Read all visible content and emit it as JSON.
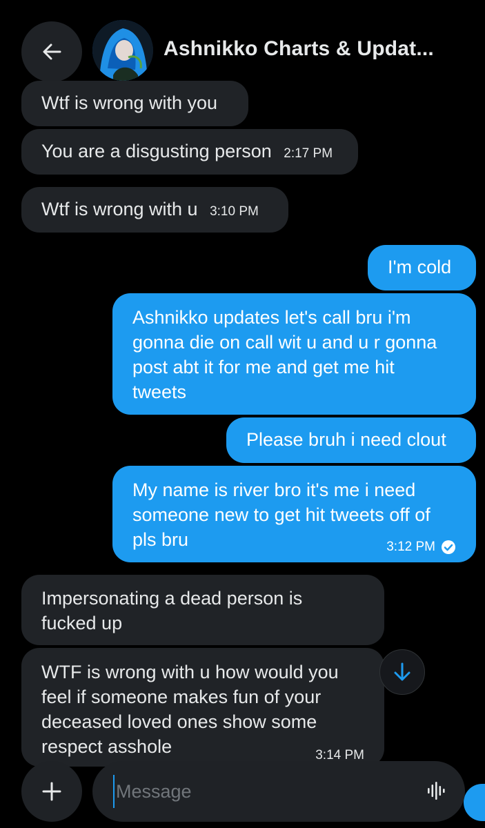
{
  "header": {
    "title": "Ashnikko Charts & Updat...",
    "back_icon": "arrow-left-icon",
    "avatar_icon": "avatar-image"
  },
  "messages": [
    {
      "direction": "received",
      "lines": [
        "Wtf is wrong with you"
      ],
      "time": ""
    },
    {
      "direction": "received",
      "lines": [
        "You are a disgusting person"
      ],
      "time": "2:17 PM"
    },
    {
      "direction": "received",
      "lines": [
        "Wtf is wrong with u"
      ],
      "time": "3:10 PM"
    },
    {
      "direction": "sent",
      "lines": [
        "I'm cold"
      ],
      "time": ""
    },
    {
      "direction": "sent",
      "lines": [
        "Ashnikko updates let's call bru i'm",
        "gonna die on call wit u and u r gonna",
        "post abt it for me and get me hit",
        "tweets"
      ],
      "time": ""
    },
    {
      "direction": "sent",
      "lines": [
        "Please bruh i need clout"
      ],
      "time": ""
    },
    {
      "direction": "sent",
      "lines": [
        "My name is river bro it's me i need",
        "someone new to get hit tweets off of",
        "pls bru"
      ],
      "time": "3:12 PM",
      "read_icon": "check-circle-icon"
    },
    {
      "direction": "received",
      "lines": [
        "Impersonating a dead person is",
        "fucked up"
      ],
      "time": ""
    },
    {
      "direction": "received",
      "lines": [
        "WTF is wrong with u how would you",
        "feel if someone makes fun of your",
        "deceased loved ones show some",
        "respect asshole"
      ],
      "time": "3:14 PM"
    }
  ],
  "scroll_button_icon": "arrow-down-icon",
  "composer": {
    "add_icon": "plus-icon",
    "placeholder": "Message",
    "value": "",
    "voice_icon": "voice-waveform-icon"
  },
  "colors": {
    "background": "#000000",
    "received_bubble": "#202327",
    "sent_bubble": "#1d9bf0",
    "text": "#e7e9ea",
    "muted": "#71767b"
  }
}
